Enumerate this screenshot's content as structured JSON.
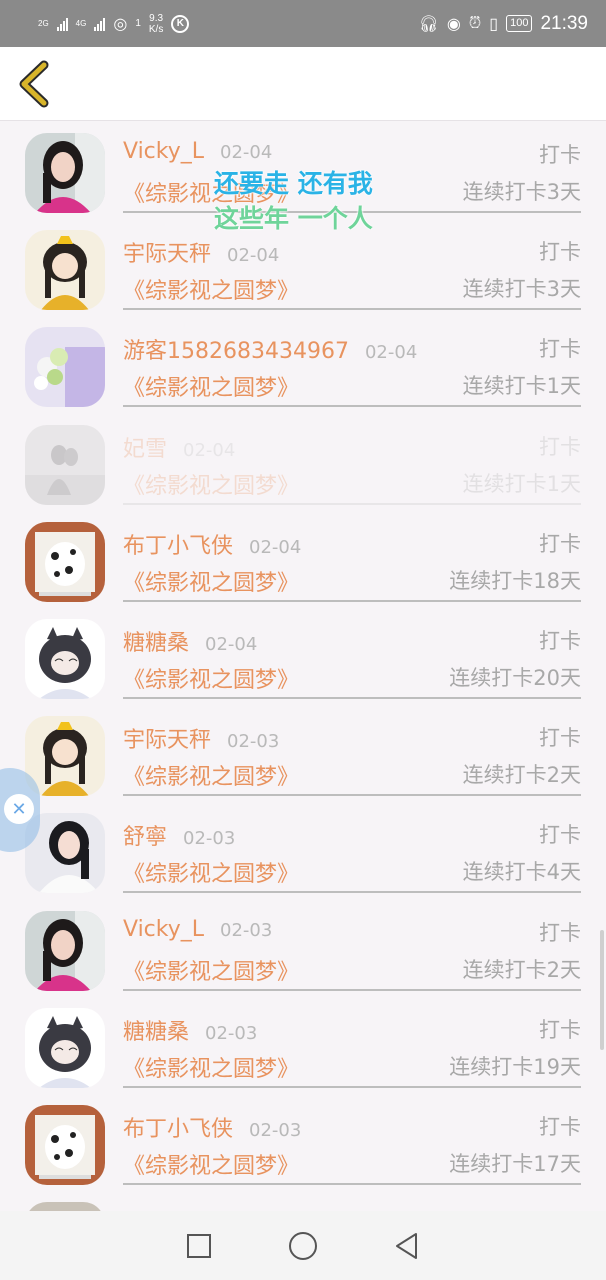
{
  "status_bar": {
    "net_label_1": "2G",
    "net_label_2": "4G",
    "wifi_count": "1",
    "speed_value": "9.3",
    "speed_unit": "K/s",
    "k_badge": "K",
    "battery": "100",
    "time": "21:39"
  },
  "overlay_caption": {
    "line1": "还要走 还有我",
    "line2": "这些年 一个人"
  },
  "list": [
    {
      "name": "Vicky_L",
      "date": "02-04",
      "action": "打卡",
      "book": "《综影视之圆梦》",
      "streak": "连续打卡3天",
      "avatar": "woman-pink"
    },
    {
      "name": "宇际天秤",
      "date": "02-04",
      "action": "打卡",
      "book": "《综影视之圆梦》",
      "streak": "连续打卡3天",
      "avatar": "anime-yellow"
    },
    {
      "name": "游客1582683434967",
      "date": "02-04",
      "action": "打卡",
      "book": "《综影视之圆梦》",
      "streak": "连续打卡1天",
      "avatar": "flowers"
    },
    {
      "name": "妃雪",
      "date": "02-04",
      "action": "打卡",
      "book": "《综影视之圆梦》",
      "streak": "连续打卡1天",
      "avatar": "couple-gray"
    },
    {
      "name": "布丁小飞侠",
      "date": "02-04",
      "action": "打卡",
      "book": "《综影视之圆梦》",
      "streak": "连续打卡18天",
      "avatar": "dalmatian"
    },
    {
      "name": "糖糖桑",
      "date": "02-04",
      "action": "打卡",
      "book": "《综影视之圆梦》",
      "streak": "连续打卡20天",
      "avatar": "anime-cat"
    },
    {
      "name": "宇际天秤",
      "date": "02-03",
      "action": "打卡",
      "book": "《综影视之圆梦》",
      "streak": "连续打卡2天",
      "avatar": "anime-yellow"
    },
    {
      "name": "舒寧",
      "date": "02-03",
      "action": "打卡",
      "book": "《综影视之圆梦》",
      "streak": "连续打卡4天",
      "avatar": "woman-white"
    },
    {
      "name": "Vicky_L",
      "date": "02-03",
      "action": "打卡",
      "book": "《综影视之圆梦》",
      "streak": "连续打卡2天",
      "avatar": "woman-pink"
    },
    {
      "name": "糖糖桑",
      "date": "02-03",
      "action": "打卡",
      "book": "《综影视之圆梦》",
      "streak": "连续打卡19天",
      "avatar": "anime-cat"
    },
    {
      "name": "布丁小飞侠",
      "date": "02-03",
      "action": "打卡",
      "book": "《综影视之圆梦》",
      "streak": "连续打卡17天",
      "avatar": "dalmatian"
    },
    {
      "name": "",
      "date": "",
      "action": "",
      "book": "",
      "streak": "",
      "avatar": "partial"
    }
  ],
  "icons": {
    "back": "chevron-left-icon",
    "float": "close-circle-icon",
    "nav_recent": "square-icon",
    "nav_home": "circle-icon",
    "nav_back": "triangle-back-icon"
  },
  "colors": {
    "accent": "#e8935f",
    "muted": "#a8a8a8",
    "back_chevron": "#d8b52a"
  }
}
